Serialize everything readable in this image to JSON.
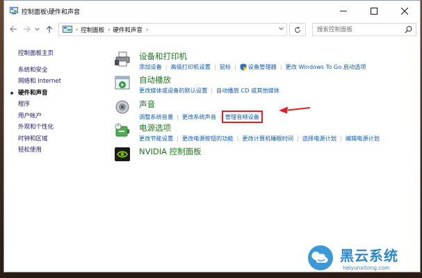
{
  "window": {
    "title": "控制面板\\硬件和声音",
    "controls": {
      "minimize": "minimize-icon",
      "maximize": "maximize-icon",
      "close": "close-icon"
    }
  },
  "navigation": {
    "back_icon": "arrow-left-icon",
    "forward_icon": "arrow-right-icon",
    "recent_icon": "chevron-down-icon",
    "up_icon": "arrow-up-icon",
    "breadcrumb": [
      "控制面板",
      "硬件和声音"
    ],
    "search_placeholder": "搜索控制面板"
  },
  "sidebar": {
    "items": [
      {
        "label": "控制面板主页"
      },
      {
        "label": "系统和安全"
      },
      {
        "label": "网络和 Internet"
      },
      {
        "label": "硬件和声音",
        "current": true
      },
      {
        "label": "程序"
      },
      {
        "label": "用户帐户"
      },
      {
        "label": "外观和个性化"
      },
      {
        "label": "时钟和区域"
      },
      {
        "label": "轻松使用"
      }
    ]
  },
  "categories": [
    {
      "title": "设备和打印机",
      "icon": "printer-icon",
      "links": [
        "添加设备",
        "高级打印机设置",
        "鼠标",
        "设备管理器",
        "更改 Windows To Go 启动选项"
      ]
    },
    {
      "title": "自动播放",
      "icon": "autoplay-icon",
      "links": [
        "更改媒体或设备的默认设置",
        "自动播放 CD 或其他媒体"
      ]
    },
    {
      "title": "声音",
      "icon": "speaker-icon",
      "links": [
        "调整系统音量",
        "更改系统声音",
        "管理音频设备"
      ]
    },
    {
      "title": "电源选项",
      "icon": "power-icon",
      "links": [
        "更改节能设置",
        "更改电源按钮的功能",
        "更改计算机睡眠时间",
        "选择电源计划",
        "编辑电源计划"
      ]
    },
    {
      "title": "NVIDIA 控制面板",
      "icon": "nvidia-icon",
      "links": []
    }
  ],
  "watermark": {
    "brand": "黑云系统",
    "url": "heiyunxitong.com"
  },
  "colors": {
    "category_title": "#1a7a1a",
    "link": "#0b5cbf",
    "annotation": "#e02020",
    "watermark": "#2b88c8"
  }
}
